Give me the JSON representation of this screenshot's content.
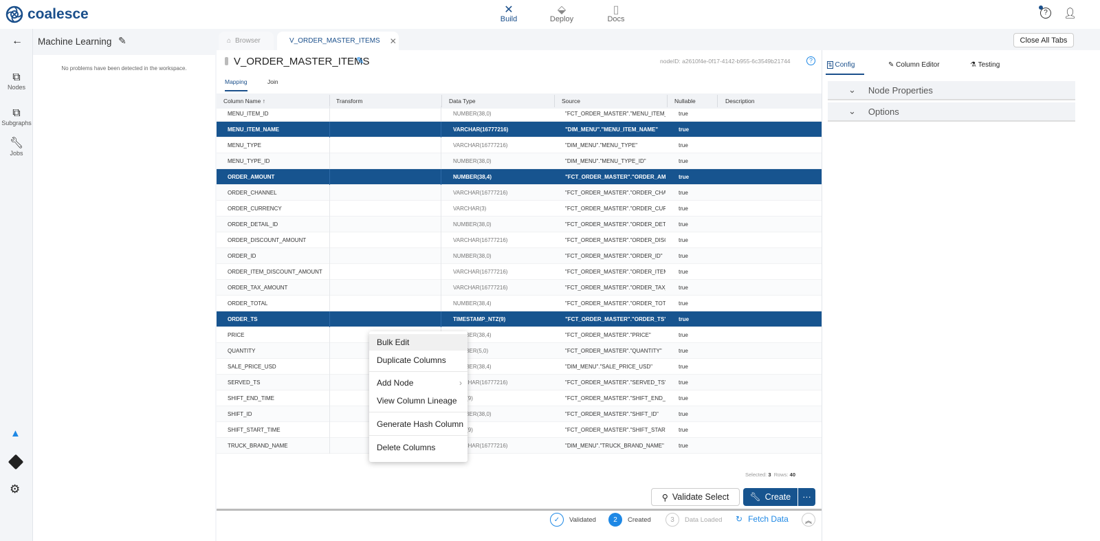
{
  "app": {
    "brand": "coalesce"
  },
  "topnav": [
    {
      "label": "Build",
      "icon": "tools-icon",
      "active": true
    },
    {
      "label": "Deploy",
      "icon": "deploy-icon"
    },
    {
      "label": "Docs",
      "icon": "docs-icon"
    }
  ],
  "rail": [
    {
      "label": "Nodes"
    },
    {
      "label": "Subgraphs"
    },
    {
      "label": "Jobs"
    }
  ],
  "workspace": {
    "title": "Machine Learning",
    "problems": "No problems have been detected in the workspace."
  },
  "tabs": {
    "browser": "Browser",
    "node": "V_ORDER_MASTER_ITEMS",
    "close_all": "Close All Tabs"
  },
  "node": {
    "title": "V_ORDER_MASTER_ITEMS",
    "node_id": "nodeID: a2610f4e-0f17-4142-b955-6c3549b21744",
    "subtabs": [
      "Mapping",
      "Join"
    ]
  },
  "columns": [
    "Column Name",
    "Transform",
    "Data Type",
    "Source",
    "Nullable",
    "Description"
  ],
  "rows": [
    {
      "name": "MENU_ITEM_ID",
      "type": "NUMBER(38,0)",
      "source": "\"FCT_ORDER_MASTER\".\"MENU_ITEM_ID\"",
      "nullable": "true",
      "selected": false
    },
    {
      "name": "MENU_ITEM_NAME",
      "type": "VARCHAR(16777216)",
      "source": "\"DIM_MENU\".\"MENU_ITEM_NAME\"",
      "nullable": "true",
      "selected": true
    },
    {
      "name": "MENU_TYPE",
      "type": "VARCHAR(16777216)",
      "source": "\"DIM_MENU\".\"MENU_TYPE\"",
      "nullable": "true",
      "selected": false
    },
    {
      "name": "MENU_TYPE_ID",
      "type": "NUMBER(38,0)",
      "source": "\"DIM_MENU\".\"MENU_TYPE_ID\"",
      "nullable": "true",
      "selected": false
    },
    {
      "name": "ORDER_AMOUNT",
      "type": "NUMBER(38,4)",
      "source": "\"FCT_ORDER_MASTER\".\"ORDER_AMOUNT\"",
      "nullable": "true",
      "selected": true
    },
    {
      "name": "ORDER_CHANNEL",
      "type": "VARCHAR(16777216)",
      "source": "\"FCT_ORDER_MASTER\".\"ORDER_CHANNEL\"",
      "nullable": "true",
      "selected": false
    },
    {
      "name": "ORDER_CURRENCY",
      "type": "VARCHAR(3)",
      "source": "\"FCT_ORDER_MASTER\".\"ORDER_CURRENCY\"",
      "nullable": "true",
      "selected": false
    },
    {
      "name": "ORDER_DETAIL_ID",
      "type": "NUMBER(38,0)",
      "source": "\"FCT_ORDER_MASTER\".\"ORDER_DETAIL_ID\"",
      "nullable": "true",
      "selected": false
    },
    {
      "name": "ORDER_DISCOUNT_AMOUNT",
      "type": "VARCHAR(16777216)",
      "source": "\"FCT_ORDER_MASTER\".\"ORDER_DISCOUNT_AMOUNT\"",
      "nullable": "true",
      "selected": false
    },
    {
      "name": "ORDER_ID",
      "type": "NUMBER(38,0)",
      "source": "\"FCT_ORDER_MASTER\".\"ORDER_ID\"",
      "nullable": "true",
      "selected": false
    },
    {
      "name": "ORDER_ITEM_DISCOUNT_AMOUNT",
      "type": "VARCHAR(16777216)",
      "source": "\"FCT_ORDER_MASTER\".\"ORDER_ITEM_DISCOUNT_AMOUNT\"",
      "nullable": "true",
      "selected": false
    },
    {
      "name": "ORDER_TAX_AMOUNT",
      "type": "VARCHAR(16777216)",
      "source": "\"FCT_ORDER_MASTER\".\"ORDER_TAX_AMOUNT\"",
      "nullable": "true",
      "selected": false
    },
    {
      "name": "ORDER_TOTAL",
      "type": "NUMBER(38,4)",
      "source": "\"FCT_ORDER_MASTER\".\"ORDER_TOTAL\"",
      "nullable": "true",
      "selected": false
    },
    {
      "name": "ORDER_TS",
      "type": "TIMESTAMP_NTZ(9)",
      "source": "\"FCT_ORDER_MASTER\".\"ORDER_TS\"",
      "nullable": "true",
      "selected": true
    },
    {
      "name": "PRICE",
      "type": "NUMBER(38,4)",
      "source": "\"FCT_ORDER_MASTER\".\"PRICE\"",
      "nullable": "true",
      "selected": false
    },
    {
      "name": "QUANTITY",
      "type": "NUMBER(5,0)",
      "source": "\"FCT_ORDER_MASTER\".\"QUANTITY\"",
      "nullable": "true",
      "selected": false
    },
    {
      "name": "SALE_PRICE_USD",
      "type": "NUMBER(38,4)",
      "source": "\"DIM_MENU\".\"SALE_PRICE_USD\"",
      "nullable": "true",
      "selected": false
    },
    {
      "name": "SERVED_TS",
      "type": "VARCHAR(16777216)",
      "source": "\"FCT_ORDER_MASTER\".\"SERVED_TS\"",
      "nullable": "true",
      "selected": false
    },
    {
      "name": "SHIFT_END_TIME",
      "type": "TIME(9)",
      "source": "\"FCT_ORDER_MASTER\".\"SHIFT_END_TIME\"",
      "nullable": "true",
      "selected": false
    },
    {
      "name": "SHIFT_ID",
      "type": "NUMBER(38,0)",
      "source": "\"FCT_ORDER_MASTER\".\"SHIFT_ID\"",
      "nullable": "true",
      "selected": false
    },
    {
      "name": "SHIFT_START_TIME",
      "type": "TIME(9)",
      "source": "\"FCT_ORDER_MASTER\".\"SHIFT_START_TIME\"",
      "nullable": "true",
      "selected": false
    },
    {
      "name": "TRUCK_BRAND_NAME",
      "type": "VARCHAR(16777216)",
      "source": "\"DIM_MENU\".\"TRUCK_BRAND_NAME\"",
      "nullable": "true",
      "selected": false
    }
  ],
  "context_menu": [
    "Bulk Edit",
    "Duplicate Columns",
    "Add Node",
    "View Column Lineage",
    "Generate Hash Column",
    "Delete Columns"
  ],
  "footer": {
    "selected_label": "Selected:",
    "selected": "3",
    "rows_label": "Rows:",
    "rows": "40",
    "validate": "Validate Select",
    "create": "Create",
    "more": "···"
  },
  "status": {
    "s1": "Validated",
    "s2_num": "2",
    "s2": "Created",
    "s3_num": "3",
    "s3": "Data Loaded",
    "fetch": "Fetch Data"
  },
  "right": {
    "tabs": [
      "Config",
      "Column Editor",
      "Testing"
    ],
    "sections": [
      "Node Properties",
      "Options"
    ]
  },
  "colors": {
    "primary": "#17548f",
    "accent": "#1e88e5"
  }
}
